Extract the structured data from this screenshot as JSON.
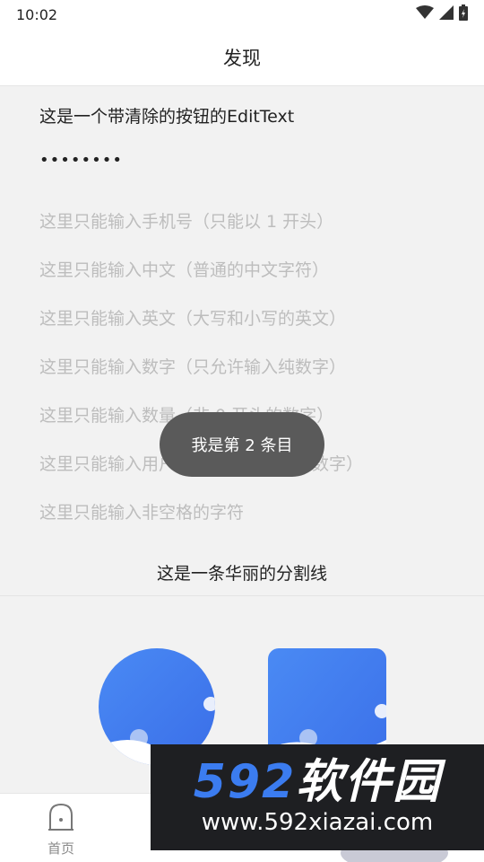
{
  "status_bar": {
    "time": "10:02",
    "icons": [
      "wifi-icon",
      "signal-icon",
      "battery-charging-icon"
    ]
  },
  "app_bar": {
    "title": "发现"
  },
  "form": {
    "edittext_value": "这是一个带清除的按钮的EditText",
    "password_value": "••••••••",
    "hints": [
      "这里只能输入手机号（只能以 1 开头）",
      "这里只能输入中文（普通的中文字符）",
      "这里只能输入英文（大写和小写的英文）",
      "这里只能输入数字（只允许输入纯数字）",
      "这里只能输入数量（非 0 开头的数字）",
      "这里只能输入用户名（中文、英文、数字）",
      "这里只能输入非空格的字符"
    ]
  },
  "divider": {
    "label": "这是一条华丽的分割线"
  },
  "toast": {
    "text": "我是第 2 条目"
  },
  "bottom_nav": {
    "home_label": "首页",
    "home_icon": "home-icon"
  },
  "watermark": {
    "brand_number": "592",
    "brand_text": "软件园",
    "url": "www.592xiazai.com"
  },
  "colors": {
    "accent_blue": "#3b7cf0",
    "hint_gray": "#bdbdbd",
    "toast_bg": "#5a5a5a"
  }
}
